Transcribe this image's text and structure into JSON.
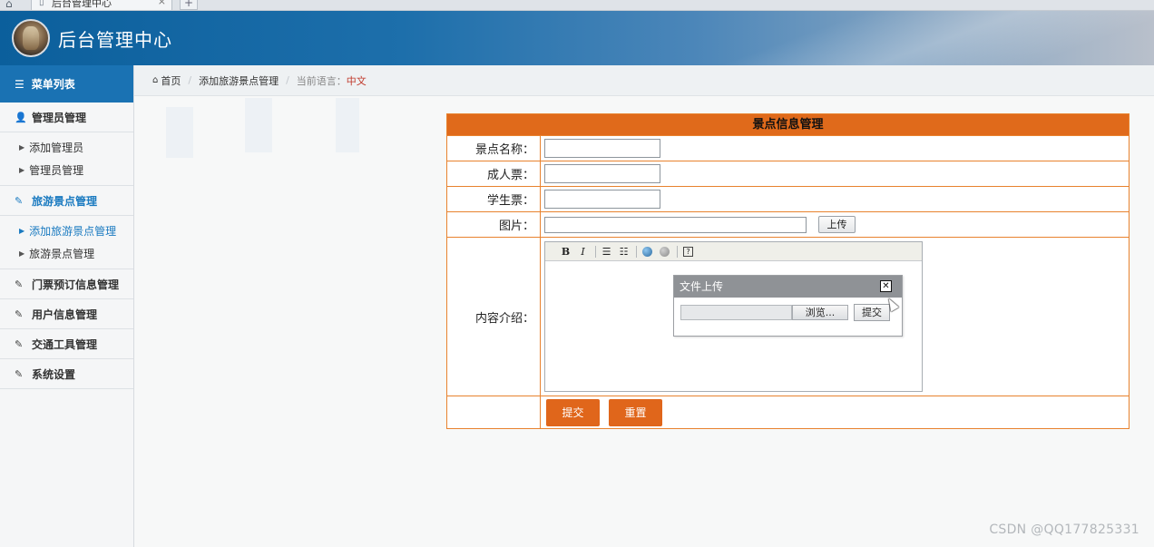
{
  "browser": {
    "tab_title": "后台管理中心",
    "tab_close": "×",
    "new_tab": "+"
  },
  "header": {
    "title": "后台管理中心"
  },
  "sidebar": {
    "heading": "菜单列表",
    "groups": [
      {
        "label": "管理员管理",
        "icon": "user-icon",
        "items": [
          "添加管理员",
          "管理员管理"
        ]
      },
      {
        "label": "旅游景点管理",
        "icon": "edit-icon",
        "active": true,
        "items": [
          "添加旅游景点管理",
          "旅游景点管理"
        ],
        "active_item": "添加旅游景点管理"
      },
      {
        "label": "门票预订信息管理",
        "icon": "edit-icon"
      },
      {
        "label": "用户信息管理",
        "icon": "edit-icon"
      },
      {
        "label": "交通工具管理",
        "icon": "edit-icon"
      },
      {
        "label": "系统设置",
        "icon": "edit-icon"
      }
    ]
  },
  "breadcrumb": {
    "home": "首页",
    "current": "添加旅游景点管理",
    "lang_label": "当前语言：",
    "lang_value": "中文"
  },
  "form": {
    "title": "景点信息管理",
    "fields": {
      "name": {
        "label": "景点名称：",
        "value": ""
      },
      "adult": {
        "label": "成人票：",
        "value": ""
      },
      "student": {
        "label": "学生票：",
        "value": ""
      },
      "image": {
        "label": "图片：",
        "value": "",
        "upload_label": "上传"
      },
      "content": {
        "label": "内容介绍："
      }
    },
    "submit_label": "提交",
    "reset_label": "重置"
  },
  "editor_toolbar": {
    "bold": "B",
    "italic": "I",
    "ordered_list": "☰",
    "unordered_list": "☷",
    "help": "?"
  },
  "upload_dialog": {
    "title": "文件上传",
    "close": "✕",
    "browse_label": "浏览...",
    "submit_label": "提交"
  },
  "watermark": "CSDN @QQ177825331",
  "colors": {
    "header_blue": "#0b5f9c",
    "sidebar_active": "#1a72b3",
    "accent_orange": "#e0661b",
    "border_orange": "#e8822e"
  }
}
